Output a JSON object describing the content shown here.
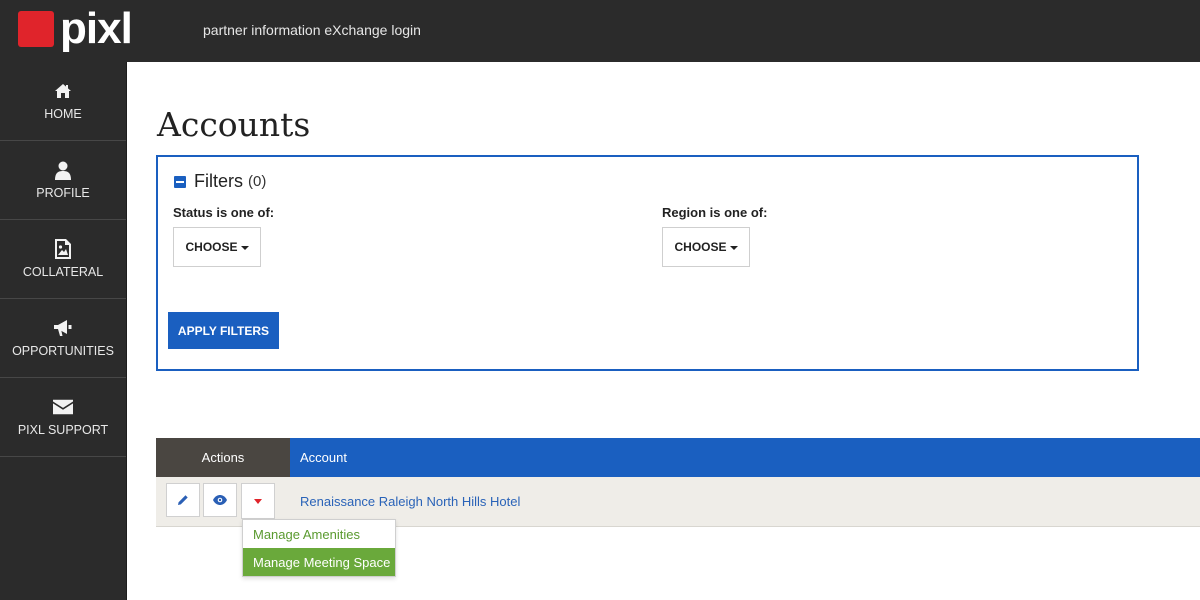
{
  "header": {
    "logo_text": "pixl",
    "tagline": "partner information eXchange login",
    "brand_color": "#e0242b"
  },
  "sidebar": {
    "items": [
      {
        "label": "HOME",
        "icon": "home-icon"
      },
      {
        "label": "PROFILE",
        "icon": "user-icon"
      },
      {
        "label": "COLLATERAL",
        "icon": "image-file-icon"
      },
      {
        "label": "OPPORTUNITIES",
        "icon": "megaphone-icon"
      },
      {
        "label": "PIXL SUPPORT",
        "icon": "envelope-icon"
      }
    ]
  },
  "page": {
    "title": "Accounts"
  },
  "filters": {
    "title": "Filters",
    "count": "(0)",
    "status_label": "Status is one of:",
    "status_button": "CHOOSE",
    "region_label": "Region is one of:",
    "region_button": "CHOOSE",
    "apply_label": "APPLY FILTERS",
    "accent_color": "#1a5fc0"
  },
  "table": {
    "columns": [
      "Actions",
      "Account"
    ],
    "rows": [
      {
        "account": "Renaissance Raleigh North Hills Hotel",
        "actions": [
          "pencil-icon",
          "eye-icon",
          "caret-down-icon"
        ]
      }
    ]
  },
  "action_menu": {
    "items": [
      {
        "label": "Manage Amenities",
        "active": false
      },
      {
        "label": "Manage Meeting Space",
        "active": true
      }
    ],
    "active_color": "#6aa93b"
  }
}
